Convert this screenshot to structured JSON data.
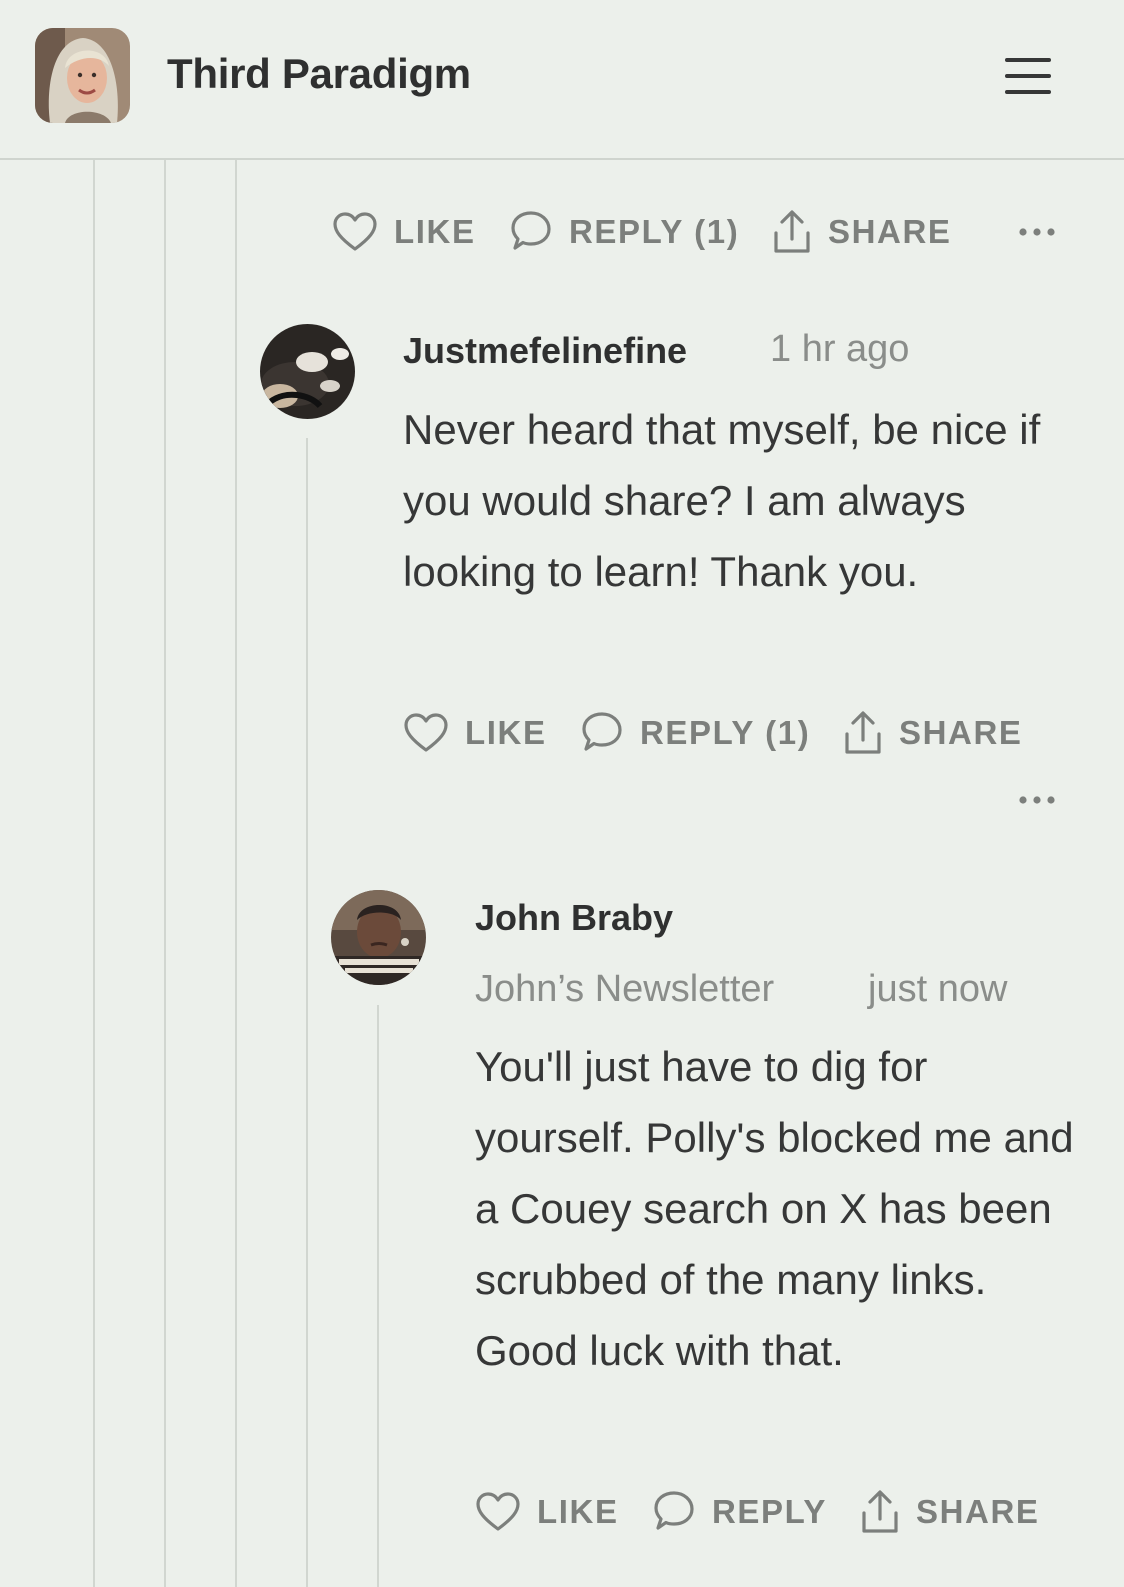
{
  "header": {
    "title": "Third Paradigm"
  },
  "top_actions": {
    "like": "LIKE",
    "reply": "REPLY (1)",
    "share": "SHARE"
  },
  "comments": [
    {
      "author": "Justmefelinefine",
      "time": "1 hr ago",
      "body": "Never heard that myself, be nice if you would share? I am always looking to learn! Thank you.",
      "like": "LIKE",
      "reply": "REPLY (1)",
      "share": "SHARE"
    },
    {
      "author": "John Braby",
      "publication": "John’s Newsletter",
      "time": "just now",
      "body": "You'll just have to dig for yourself. Polly's blocked me and a Couey search on X has been scrubbed of the many links. Good luck with that.",
      "like": "LIKE",
      "reply": "REPLY",
      "share": "SHARE"
    }
  ],
  "colors": {
    "background": "#ecf0eb",
    "text": "#363737",
    "muted": "#7c7f7c",
    "thread_line": "#d1d6d0"
  },
  "icons": [
    "menu-icon",
    "heart-icon",
    "comment-bubble-icon",
    "share-icon",
    "more-dots-icon"
  ]
}
